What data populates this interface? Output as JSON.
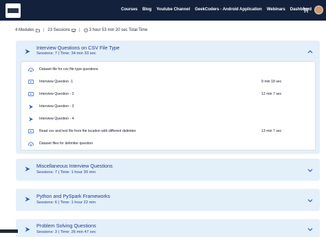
{
  "nav": {
    "links": [
      "Courses",
      "Blog",
      "Youtube Channel",
      "GeekCoders - Android Application",
      "Webinars",
      "Dashboard"
    ],
    "icons": {
      "cart": "cart-icon",
      "avatar": "user-avatar"
    }
  },
  "course": {
    "modules": "4 Modules",
    "sessions": "23 Sessions",
    "total_time": "3 hour 53 min 20 sec Total Time"
  },
  "modules": [
    {
      "title": "Interview Questions on CSV File Type",
      "subtitle": "Sessions: 7 | Time: 34 min 33 sec",
      "expanded": true,
      "items": [
        {
          "icon": "cloud-download-icon",
          "label": "Dataset file for csv file type questions",
          "time": ""
        },
        {
          "icon": "video-icon",
          "label": "Interview Question -1",
          "time": "9 min 18 sec"
        },
        {
          "icon": "video-icon",
          "label": "Interview Question - 2",
          "time": "12 min 7 sec"
        },
        {
          "icon": "chevron-right-icon",
          "label": "Interview Question - 3",
          "time": ""
        },
        {
          "icon": "chevron-right-icon",
          "label": "Interview Question - 4",
          "time": ""
        },
        {
          "icon": "video-icon",
          "label": "Read csv and text file from file location with different delimiter",
          "time": "13 min 7 sec"
        },
        {
          "icon": "cloud-download-icon",
          "label": "Dataset files for delimiter question",
          "time": ""
        }
      ]
    },
    {
      "title": "Miscellaneous Interview Questions",
      "subtitle": "Sessions: 7 | Time: 1 hour 30 min",
      "expanded": false
    },
    {
      "title": "Python and PySpark Frameworks",
      "subtitle": "Sessions: 6 | Time: 1 hour 22 min",
      "expanded": false
    },
    {
      "title": "Problem Solving Questions",
      "subtitle": "Sessions: 3 | Time: 26 min 47 sec",
      "expanded": false
    }
  ],
  "colors": {
    "nav_bg": "#14213d",
    "module_bg": "#e3eff9",
    "accent": "#1e5bb8"
  }
}
